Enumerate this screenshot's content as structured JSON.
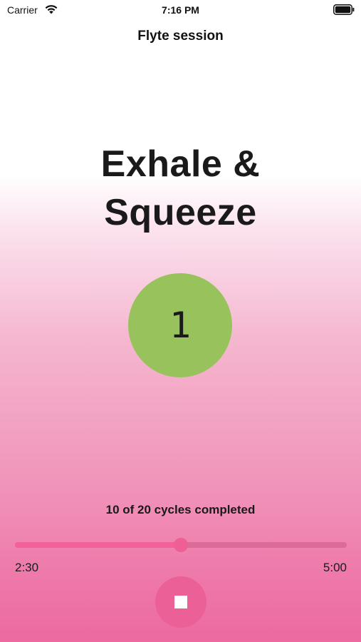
{
  "status_bar": {
    "carrier": "Carrier",
    "time": "7:16 PM",
    "icons": [
      "wifi-icon",
      "battery-icon"
    ]
  },
  "nav": {
    "title": "Flyte session"
  },
  "session": {
    "phase_line1": "Exhale &",
    "phase_line2": "Squeeze",
    "counter": "1",
    "cycles_text": "10 of 20 cycles completed",
    "elapsed": "2:30",
    "total": "5:00",
    "progress_fraction": 0.5
  },
  "controls": {
    "stop_icon": "stop-icon"
  },
  "colors": {
    "counter_circle": "#97c25c",
    "accent_pink": "#ef5e95",
    "track": "#dd6b97"
  }
}
